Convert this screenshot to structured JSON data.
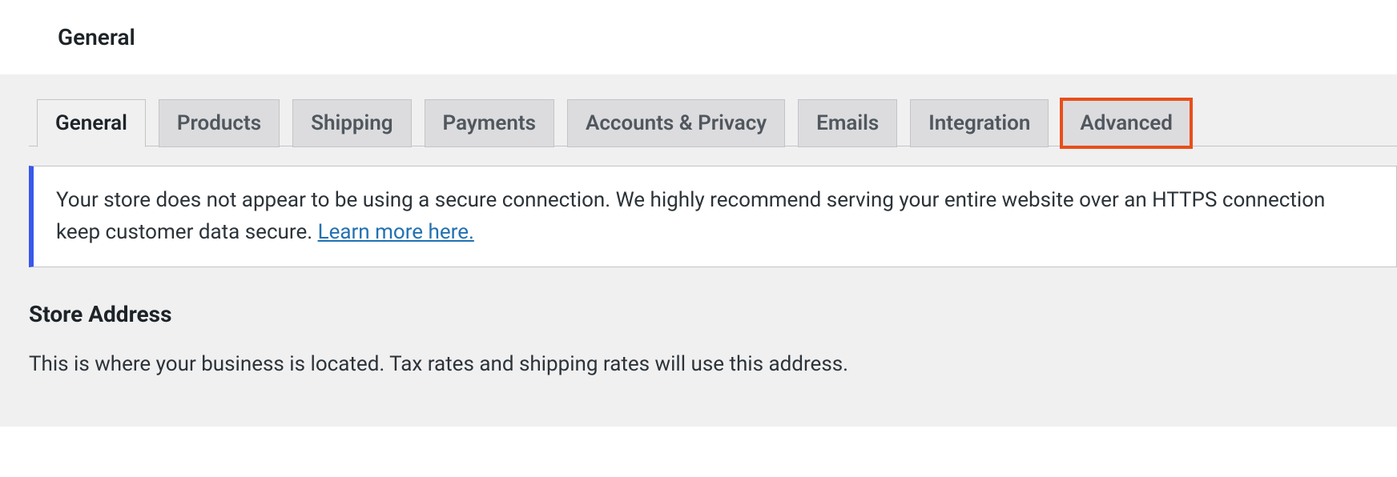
{
  "page_title": "General",
  "tabs": [
    {
      "label": "General",
      "active": true,
      "highlighted": false
    },
    {
      "label": "Products",
      "active": false,
      "highlighted": false
    },
    {
      "label": "Shipping",
      "active": false,
      "highlighted": false
    },
    {
      "label": "Payments",
      "active": false,
      "highlighted": false
    },
    {
      "label": "Accounts & Privacy",
      "active": false,
      "highlighted": false
    },
    {
      "label": "Emails",
      "active": false,
      "highlighted": false
    },
    {
      "label": "Integration",
      "active": false,
      "highlighted": false
    },
    {
      "label": "Advanced",
      "active": false,
      "highlighted": true
    }
  ],
  "notice": {
    "text_before_link": "Your store does not appear to be using a secure connection. We highly recommend serving your entire website over an HTTPS connection keep customer data secure. ",
    "link_text": "Learn more here."
  },
  "section": {
    "heading": "Store Address",
    "description": "This is where your business is located. Tax rates and shipping rates will use this address."
  }
}
